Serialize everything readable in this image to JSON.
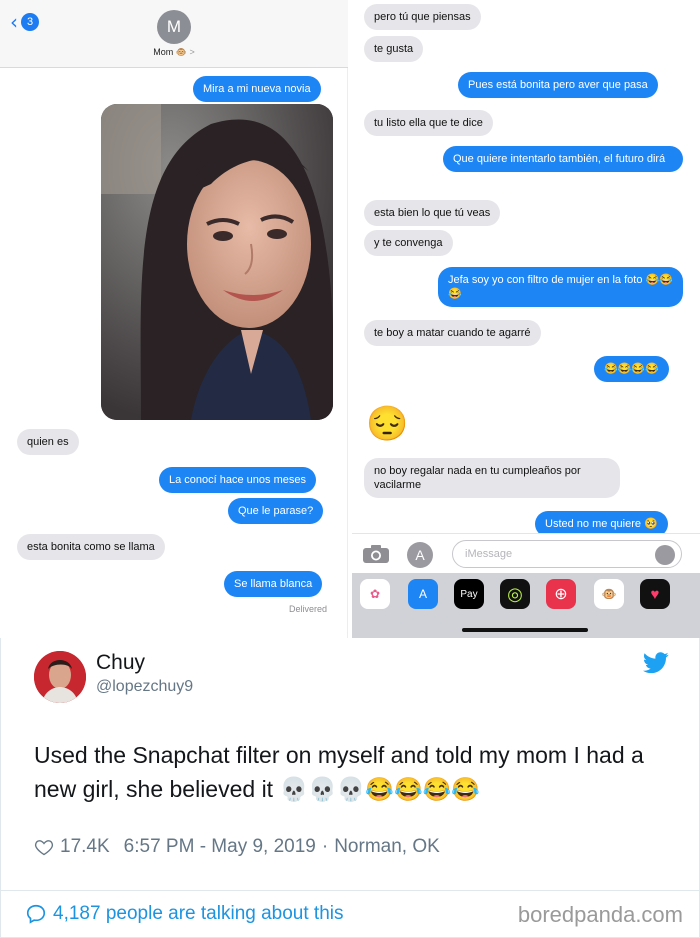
{
  "left_header": {
    "back_count": "3",
    "avatar_initial": "M",
    "contact_name": "Mom",
    "contact_emoji": "🐵",
    "chevron": ">"
  },
  "left_messages": [
    {
      "text": "Mira a mi nueva novia",
      "from": "me"
    },
    {
      "text": "quien es",
      "from": "mom"
    },
    {
      "text": "La conocí hace unos meses",
      "from": "me"
    },
    {
      "text": "Que le parase?",
      "from": "me"
    },
    {
      "text": "esta bonita como se llama",
      "from": "mom"
    },
    {
      "text": "Se llama blanca",
      "from": "me"
    }
  ],
  "delivered": "Delivered",
  "right_messages": [
    {
      "text": "pero tú que piensas",
      "from": "mom"
    },
    {
      "text": "te gusta",
      "from": "mom"
    },
    {
      "text": "Pues está bonita pero aver que pasa",
      "from": "me"
    },
    {
      "text": "tu listo ella que te dice",
      "from": "mom"
    },
    {
      "text": "Que quiere intentarlo también, el futuro dirá",
      "from": "me"
    },
    {
      "text": "esta bien lo que tú veas",
      "from": "mom"
    },
    {
      "text": "y te convenga",
      "from": "mom"
    },
    {
      "text": "Jefa soy yo con filtro de mujer en la foto 😂😂😂",
      "from": "me"
    },
    {
      "text": "te boy a matar cuando te agarré",
      "from": "mom"
    },
    {
      "text": "😂😂😂😂",
      "from": "me"
    },
    {
      "text": "😔",
      "from": "mom"
    },
    {
      "text": "no boy regalar nada en tu cumpleaños por vacilarme",
      "from": "mom"
    },
    {
      "text": "Usted no me quiere 🥺",
      "from": "me"
    }
  ],
  "input": {
    "placeholder": "iMessage"
  },
  "tray": [
    {
      "icon": "photos-icon",
      "glyph": "✿",
      "bg": "#ffffff"
    },
    {
      "icon": "appstore-icon",
      "glyph": "A",
      "bg": "#1e85f5"
    },
    {
      "icon": "applepay-icon",
      "glyph": "Pay",
      "bg": "#000000"
    },
    {
      "icon": "activity-icon",
      "glyph": "◎",
      "bg": "#111111"
    },
    {
      "icon": "search-images-icon",
      "glyph": "⊕",
      "bg": "#e9334d"
    },
    {
      "icon": "animoji-icon",
      "glyph": "🐵",
      "bg": "#ffffff"
    },
    {
      "icon": "digital-touch-icon",
      "glyph": "♥",
      "bg": "#111111"
    }
  ],
  "tweet": {
    "name": "Chuy",
    "handle": "@lopezchuy9",
    "text": "Used the Snapchat filter on myself and told my mom I had a new girl, she believed it 💀💀💀😂😂😂😂",
    "likes": "17.4K",
    "time": "6:57 PM - May 9, 2019",
    "separator": "·",
    "location": "Norman, OK"
  },
  "footer": {
    "talking": "4,187 people are talking about this",
    "watermark": "boredpanda.com"
  },
  "colors": {
    "imessage_blue": "#1e85f5",
    "bubble_gray": "#e6e6ea",
    "twitter_blue": "#1da1f2"
  }
}
